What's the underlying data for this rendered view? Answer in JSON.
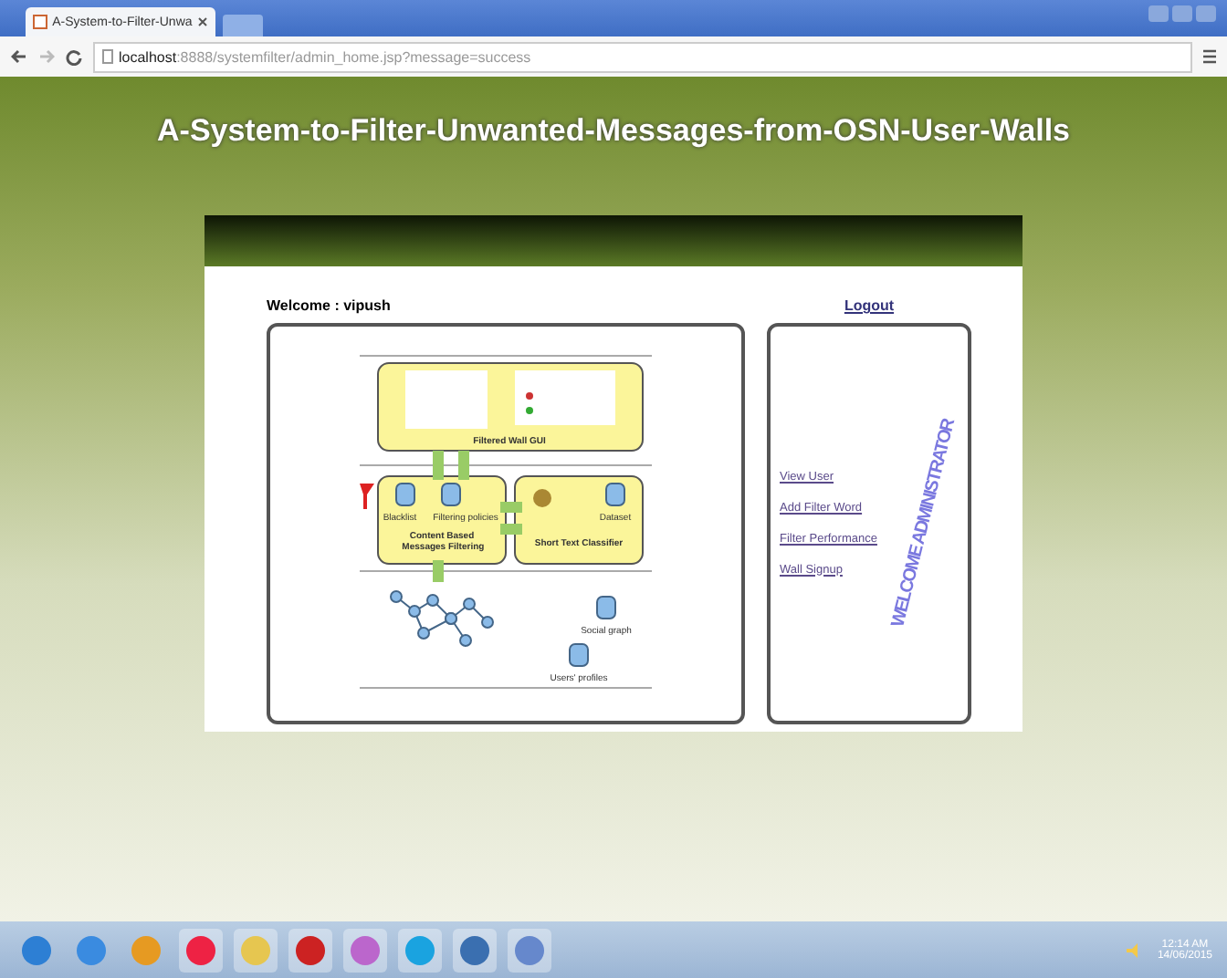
{
  "browser": {
    "tab_title": "A-System-to-Filter-Unwa",
    "url_host": "localhost",
    "url_path": ":8888/systemfilter/admin_home.jsp?message=success"
  },
  "page": {
    "title": "A-System-to-Filter-Unwanted-Messages-from-OSN-User-Walls",
    "welcome": "Welcome : vipush",
    "logout": "Logout",
    "diagram": {
      "labels": [
        {
          "kind": "box",
          "text": "Filtered Wall GUI"
        },
        {
          "kind": "db",
          "text": "Blacklist"
        },
        {
          "kind": "db",
          "text": "Filtering policies"
        },
        {
          "kind": "db",
          "text": "Dataset"
        },
        {
          "kind": "box",
          "text": "Content Based Messages Filtering"
        },
        {
          "kind": "box",
          "text": "Short Text Classifier"
        },
        {
          "kind": "db",
          "text": "Social graph"
        },
        {
          "kind": "db",
          "text": "Users' profiles"
        }
      ]
    },
    "watermark": "WELCOME ADMINISTRATOR",
    "menu": [
      {
        "label": "View User"
      },
      {
        "label": "Add Filter Word"
      },
      {
        "label": "Filter Performance"
      },
      {
        "label": "Wall Signup"
      }
    ]
  },
  "taskbar": {
    "time": "12:14 AM",
    "date": "14/06/2015"
  }
}
